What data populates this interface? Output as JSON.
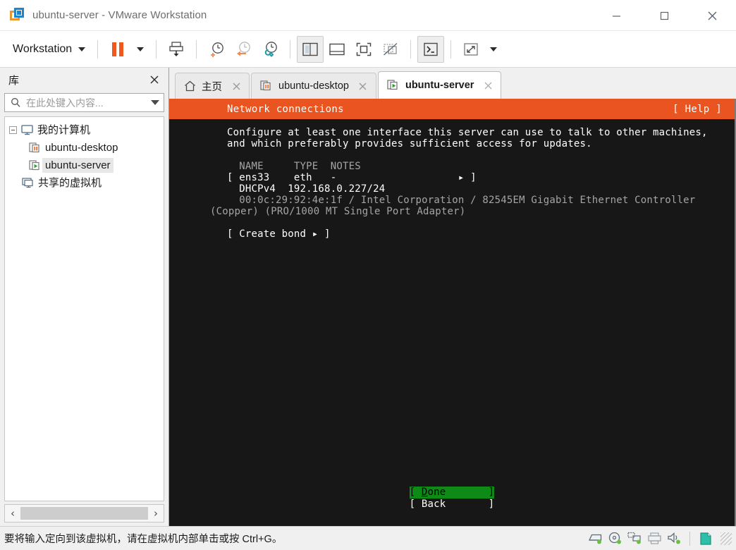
{
  "window": {
    "title": "ubuntu-server - VMware Workstation",
    "logo_icon": "vmware-logo-icon",
    "minimize_label": "—",
    "maximize_label": "□",
    "close_label": "✕"
  },
  "toolbar": {
    "menu_label": "Workstation",
    "menu_caret_icon": "chevron-down-icon",
    "buttons": [
      {
        "name": "pause-vm-button",
        "icon": "pause-icon"
      },
      {
        "name": "pause-dropdown-button",
        "icon": "chevron-down-icon"
      },
      {
        "name": "send-ctrl-alt-del-button",
        "icon": "send-keys-icon"
      },
      {
        "name": "take-snapshot-button",
        "icon": "clock-plus-icon"
      },
      {
        "name": "revert-snapshot-button",
        "icon": "clock-back-icon"
      },
      {
        "name": "snapshot-manager-button",
        "icon": "clock-wrench-icon"
      },
      {
        "name": "show-library-button",
        "icon": "panel-left-icon"
      },
      {
        "name": "show-thumbnail-bar-button",
        "icon": "panel-bottom-icon"
      },
      {
        "name": "full-screen-button",
        "icon": "fullscreen-icon"
      },
      {
        "name": "unity-mode-button",
        "icon": "unity-mode-icon"
      },
      {
        "name": "console-view-button",
        "icon": "console-icon"
      },
      {
        "name": "stretch-view-button",
        "icon": "stretch-icon"
      },
      {
        "name": "stretch-dropdown-button",
        "icon": "chevron-down-icon"
      }
    ]
  },
  "library": {
    "title": "库",
    "close_icon": "close-icon",
    "search": {
      "placeholder": "在此处键入内容...",
      "value": "",
      "icon": "search-icon",
      "dropdown_icon": "chevron-down-icon"
    },
    "tree": [
      {
        "label": "我的计算机",
        "icon": "computer-icon",
        "level": 0,
        "expanded": true,
        "selected": false
      },
      {
        "label": "ubuntu-desktop",
        "icon": "vm-paused-icon",
        "level": 1,
        "expanded": false,
        "selected": false
      },
      {
        "label": "ubuntu-server",
        "icon": "vm-running-icon",
        "level": 1,
        "expanded": false,
        "selected": true
      },
      {
        "label": "共享的虚拟机",
        "icon": "shared-vms-icon",
        "level": 0,
        "expanded": false,
        "selected": false
      }
    ],
    "hscroll": {
      "left_arrow": "‹",
      "right_arrow": "›"
    }
  },
  "tabs": [
    {
      "label": "主页",
      "icon": "home-icon",
      "active": false,
      "close_icon": "close-icon"
    },
    {
      "label": "ubuntu-desktop",
      "icon": "vm-paused-icon",
      "active": false,
      "close_icon": "close-icon"
    },
    {
      "label": "ubuntu-server",
      "icon": "vm-running-icon",
      "active": true,
      "close_icon": "close-icon"
    }
  ],
  "terminal": {
    "header_title": "Network connections",
    "header_help": "[ Help ]",
    "description_lines": [
      "Configure at least one interface this server can use to talk to other machines,",
      "and which preferably provides sufficient access for updates."
    ],
    "table_header": "  NAME     TYPE  NOTES",
    "rows": [
      {
        "text": "[ ens33    eth   -                    ▸ ]",
        "dim": false
      },
      {
        "text": "  DHCPv4  192.168.0.227/24",
        "dim": false
      },
      {
        "text": "  00:0c:29:92:4e:1f / Intel Corporation / 82545EM Gigabit Ethernet Controller",
        "dim": true
      },
      {
        "text": "(Copper) (PRO/1000 MT Single Port Adapter)",
        "dim": true,
        "nopad": true
      }
    ],
    "create_bond": "[ Create bond ▸ ]",
    "footer_buttons": [
      {
        "bracket_open": "[ ",
        "label": "Done",
        "bracket_close": " ]",
        "active": true,
        "underline_first": true
      },
      {
        "bracket_open": "[ ",
        "label": "Back",
        "bracket_close": " ]",
        "active": false,
        "underline_first": false
      }
    ],
    "colors": {
      "header_bg": "#e95420",
      "background": "#171717",
      "active_button_bg": "#0e8a17",
      "dim_text": "#a5a5a5"
    }
  },
  "statusbar": {
    "message": "要将输入定向到该虚拟机，请在虚拟机内部单击或按 Ctrl+G。",
    "icons": [
      {
        "name": "hard-disk-status-icon"
      },
      {
        "name": "cd-dvd-status-icon"
      },
      {
        "name": "network-adapter-status-icon"
      },
      {
        "name": "printer-status-icon"
      },
      {
        "name": "sound-card-status-icon"
      }
    ],
    "usb_icon": "usb-device-status-icon",
    "resize_grip_icon": "resize-grip-icon"
  }
}
